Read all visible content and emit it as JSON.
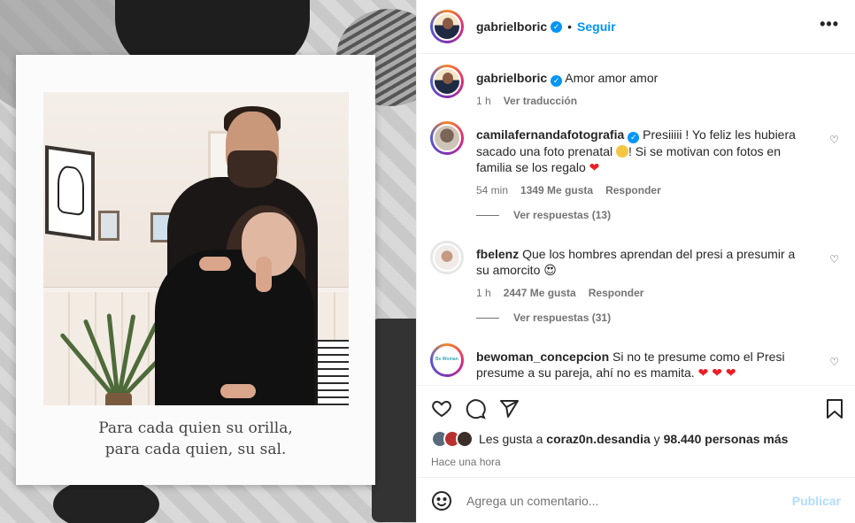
{
  "header": {
    "username": "gabrielboric",
    "verified_icon": "check-icon",
    "dot": "•",
    "follow_label": "Seguir",
    "more_icon": "•••"
  },
  "media": {
    "caption_line1": "Para cada quien su orilla,",
    "caption_line2": "para cada quien, su sal."
  },
  "post_caption": {
    "username": "gabrielboric",
    "text": "Amor amor amor",
    "time": "1 h",
    "translate_label": "Ver traducción"
  },
  "comments": [
    {
      "username": "camilafernandafotografia",
      "text_before": "Presiiiii ! Yo feliz les hubiera sacado una foto prenatal ",
      "text_after": "! Si se motivan con fotos en familia se los regalo ",
      "emoji_end": "❤",
      "time": "54 min",
      "likes": "1349 Me gusta",
      "reply_label": "Responder",
      "view_replies": "Ver respuestas (13)"
    },
    {
      "username": "fbelenz",
      "text": "Que los hombres aprendan del presi a presumir a su amorcito ",
      "emoji": "😍",
      "time": "1 h",
      "likes": "2447 Me gusta",
      "reply_label": "Responder",
      "view_replies": "Ver respuestas (31)"
    },
    {
      "username": "bewoman_concepcion",
      "text": "Si no te presume como el Presi presume a su pareja, ahí no es mamita. ",
      "emoji": "❤ ❤ ❤"
    }
  ],
  "actions": {
    "likes_prefix": "Les gusta a",
    "likes_user": "coraz0n.desandia",
    "likes_and": "y",
    "likes_count": "98.440 personas más",
    "time": "Hace una hora"
  },
  "add_comment": {
    "placeholder": "Agrega un comentario...",
    "post_label": "Publicar"
  },
  "colors": {
    "accent": "#0095f6",
    "heart": "#ed1c24",
    "publish_disabled": "#b3dbff"
  }
}
